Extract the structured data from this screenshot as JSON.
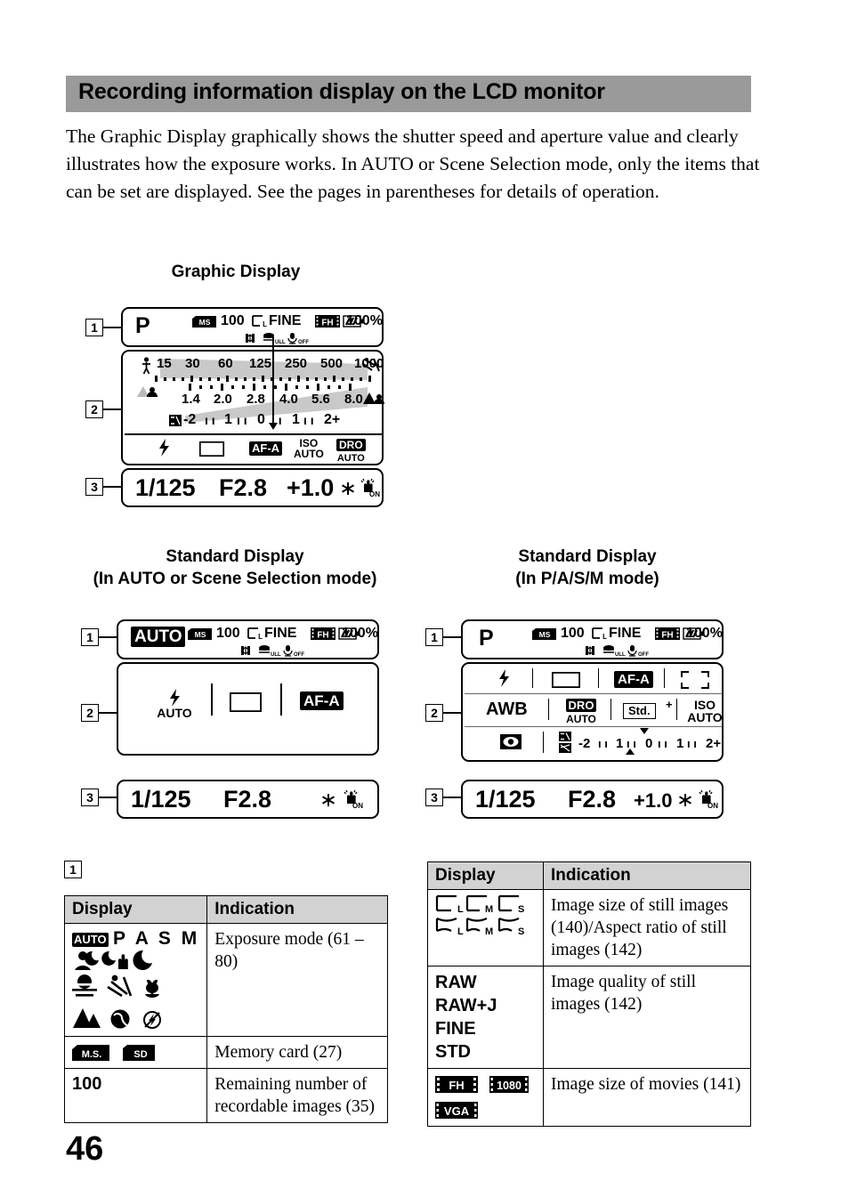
{
  "header": {
    "title": "Recording information display on the LCD monitor",
    "bar_color": "#9a9a9a"
  },
  "intro": "The Graphic Display graphically shows the shutter speed and aperture value and clearly illustrates how the exposure works. In AUTO or Scene Selection mode, only the items that can be set are displayed. See the pages in parentheses for details of operation.",
  "captions": {
    "graphic": "Graphic Display",
    "standard_auto_line1": "Standard Display",
    "standard_auto_line2": "(In AUTO or Scene Selection mode)",
    "standard_pasm_line1": "Standard Display",
    "standard_pasm_line2": "(In P/A/S/M mode)"
  },
  "markers": {
    "one": "1",
    "two": "2",
    "three": "3"
  },
  "graphic_display": {
    "row1": {
      "mode": "P",
      "card": "MS",
      "remaining": "100",
      "quality": "FINE",
      "movie_size": "FH",
      "battery": "100%",
      "icons": [
        "shake-warning-icon",
        "flash-full-icon",
        "mic-off-icon"
      ],
      "flash_label": "ULL",
      "mic_label": "OFF"
    },
    "scale": {
      "shutter_values": [
        "15",
        "30",
        "60",
        "125",
        "250",
        "500",
        "1000"
      ],
      "aperture_values": [
        "1.4",
        "2.0",
        "2.8",
        "4.0",
        "5.6",
        "8.0"
      ],
      "ev_labels": [
        "-2",
        "1",
        "0",
        "1",
        "2+"
      ]
    },
    "row3": {
      "flash_mode": "flash-icon",
      "drive_mode": "single-frame-icon",
      "af_mode": "AF-A",
      "iso_label": "ISO",
      "iso_value": "AUTO",
      "dro_label": "DRO",
      "dro_value": "AUTO"
    },
    "row4": {
      "shutter": "1/125",
      "aperture": "F2.8",
      "exposure": "+1.0",
      "ae_lock": "ae-lock-icon",
      "steadyshot": "ON"
    }
  },
  "standard_auto": {
    "row1": {
      "mode": "AUTO",
      "card": "MS",
      "remaining": "100",
      "quality": "FINE",
      "movie_size": "FH",
      "battery": "100%",
      "flash_label": "ULL",
      "mic_label": "OFF"
    },
    "row2": {
      "flash_mode_label": "AUTO",
      "drive_mode": "single-frame-icon",
      "af_mode": "AF-A"
    },
    "row3": {
      "shutter": "1/125",
      "aperture": "F2.8",
      "ae_lock": "ae-lock-icon",
      "steadyshot": "ON"
    }
  },
  "standard_pasm": {
    "row1": {
      "mode": "P",
      "card": "MS",
      "remaining": "100",
      "quality": "FINE",
      "movie_size": "FH",
      "battery": "100%",
      "flash_label": "ULL",
      "mic_label": "OFF"
    },
    "row2a": {
      "flash_mode": "flash-icon",
      "drive_mode": "single-frame-icon",
      "af_mode": "AF-A",
      "af_area": "af-area-icon"
    },
    "row2b": {
      "white_balance": "AWB",
      "dro_label": "DRO",
      "dro_value": "AUTO",
      "creative_style": "Std.",
      "iso_label": "ISO",
      "iso_value": "AUTO"
    },
    "row2c": {
      "metering": "spot-metering-icon",
      "ev_labels": [
        "-2",
        "1",
        "0",
        "1",
        "2+"
      ]
    },
    "row3": {
      "shutter": "1/125",
      "aperture": "F2.8",
      "exposure": "+1.0",
      "ae_lock": "ae-lock-icon",
      "steadyshot": "ON"
    }
  },
  "table_left": {
    "marker": "1",
    "headers": [
      "Display",
      "Indication"
    ],
    "rows": [
      {
        "display_kind": "exposure-modes",
        "display_text": "P A S M",
        "auto_badge": "AUTO",
        "indication": "Exposure mode (61 – 80)"
      },
      {
        "display_kind": "memory-cards",
        "ms_label": "M.S.",
        "sd_label": "SD",
        "indication": "Memory card (27)"
      },
      {
        "display_kind": "text",
        "display_text": "100",
        "indication": "Remaining number of recordable images (35)"
      }
    ]
  },
  "table_right": {
    "headers": [
      "Display",
      "Indication"
    ],
    "rows": [
      {
        "display_kind": "image-sizes",
        "sizes_row1": [
          "L",
          "M",
          "S"
        ],
        "sizes_row2": [
          "L",
          "M",
          "S"
        ],
        "indication": "Image size of still images (140)/Aspect ratio of still images (142)"
      },
      {
        "display_kind": "quality-list",
        "items": [
          "RAW",
          "RAW+J",
          "FINE",
          "STD"
        ],
        "indication": "Image quality of still images (142)"
      },
      {
        "display_kind": "movie-sizes",
        "items": [
          "FH",
          "1080",
          "VGA"
        ],
        "indication": "Image size of movies (141)"
      }
    ]
  },
  "page_number": "46"
}
